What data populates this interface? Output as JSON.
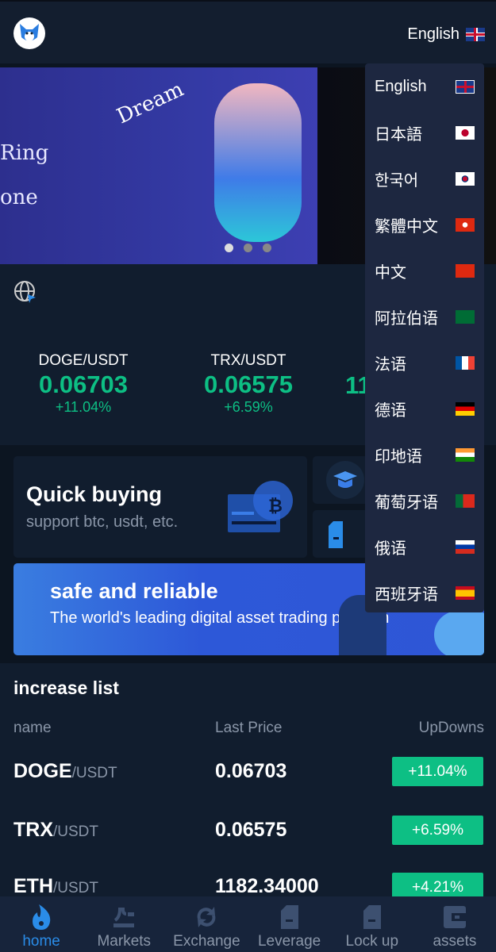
{
  "header": {
    "language": "English",
    "flag": "uk"
  },
  "banner": {
    "text_lines": [
      "Ring",
      "one"
    ],
    "dream": "Dream",
    "dots": 3,
    "active_dot": 0
  },
  "tickers": [
    {
      "pair": "DOGE/USDT",
      "price": "0.06703",
      "change": "+11.04%"
    },
    {
      "pair": "TRX/USDT",
      "price": "0.06575",
      "change": "+6.59%"
    },
    {
      "pair": "",
      "price": "11",
      "change": ""
    }
  ],
  "quick_buy": {
    "title": "Quick buying",
    "subtitle": "support btc, usdt, etc."
  },
  "promo": {
    "title": "safe and reliable",
    "subtitle": "The world's leading digital asset trading platform"
  },
  "increase_list": {
    "title": "increase list",
    "columns": [
      "name",
      "Last Price",
      "UpDowns"
    ],
    "rows": [
      {
        "base": "DOGE",
        "quote": "/USDT",
        "price": "0.06703",
        "change": "+11.04%"
      },
      {
        "base": "TRX",
        "quote": "/USDT",
        "price": "0.06575",
        "change": "+6.59%"
      },
      {
        "base": "ETH",
        "quote": "/USDT",
        "price": "1182.34000",
        "change": "+4.21%"
      }
    ],
    "up_color": "#0dbf84"
  },
  "nav": [
    {
      "label": "home",
      "icon": "flame-icon",
      "active": true
    },
    {
      "label": "Markets",
      "icon": "markets-icon"
    },
    {
      "label": "Exchange",
      "icon": "refresh-icon"
    },
    {
      "label": "Leverage",
      "icon": "document-icon"
    },
    {
      "label": "Lock up",
      "icon": "document-icon"
    },
    {
      "label": "assets",
      "icon": "wallet-icon"
    }
  ],
  "languages": [
    {
      "label": "English",
      "flag": "uk"
    },
    {
      "label": "日本語",
      "flag": "jp"
    },
    {
      "label": "한국어",
      "flag": "kr"
    },
    {
      "label": "繁體中文",
      "flag": "hk"
    },
    {
      "label": "中文",
      "flag": "cn"
    },
    {
      "label": "阿拉伯语",
      "flag": "sa"
    },
    {
      "label": "法语",
      "flag": "fr"
    },
    {
      "label": "德语",
      "flag": "de"
    },
    {
      "label": "印地语",
      "flag": "in"
    },
    {
      "label": "葡萄牙语",
      "flag": "pt"
    },
    {
      "label": "俄语",
      "flag": "ru"
    },
    {
      "label": "西班牙语",
      "flag": "es"
    }
  ],
  "accent": "#2a8ce8"
}
